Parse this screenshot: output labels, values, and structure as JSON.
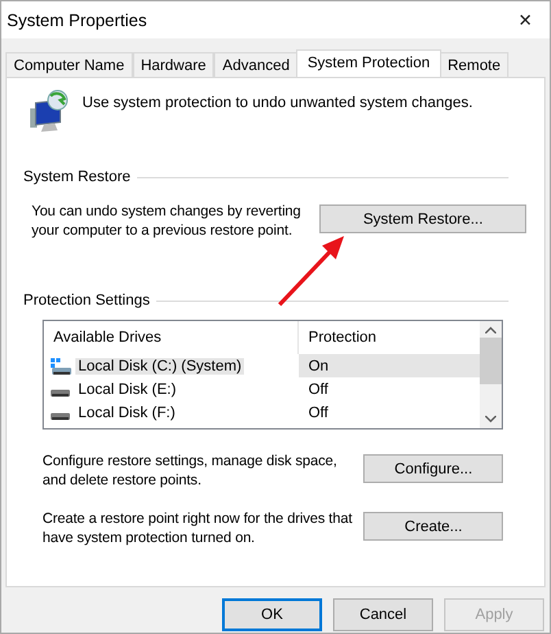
{
  "window": {
    "title": "System Properties",
    "close": "✕"
  },
  "tabs": [
    {
      "label": "Computer Name",
      "selected": false
    },
    {
      "label": "Hardware",
      "selected": false
    },
    {
      "label": "Advanced",
      "selected": false
    },
    {
      "label": "System Protection",
      "selected": true
    },
    {
      "label": "Remote",
      "selected": false
    }
  ],
  "intro": "Use system protection to undo unwanted system changes.",
  "system_restore": {
    "title": "System Restore",
    "text": "You can undo system changes by reverting your computer to a previous restore point.",
    "button": "System Restore..."
  },
  "protection_settings": {
    "title": "Protection Settings",
    "columns": [
      "Available Drives",
      "Protection"
    ],
    "rows": [
      {
        "drive": "Local Disk (C:) (System)",
        "protection": "On",
        "system": true,
        "selected": true
      },
      {
        "drive": "Local Disk (E:)",
        "protection": "Off",
        "system": false,
        "selected": false
      },
      {
        "drive": "Local Disk (F:)",
        "protection": "Off",
        "system": false,
        "selected": false
      }
    ],
    "configure_text": "Configure restore settings, manage disk space, and delete restore points.",
    "configure_button": "Configure...",
    "create_text": "Create a restore point right now for the drives that have system protection turned on.",
    "create_button": "Create..."
  },
  "buttons": [
    {
      "label": "OK",
      "default": true,
      "disabled": false
    },
    {
      "label": "Cancel",
      "default": false,
      "disabled": false
    },
    {
      "label": "Apply",
      "default": false,
      "disabled": true
    }
  ]
}
